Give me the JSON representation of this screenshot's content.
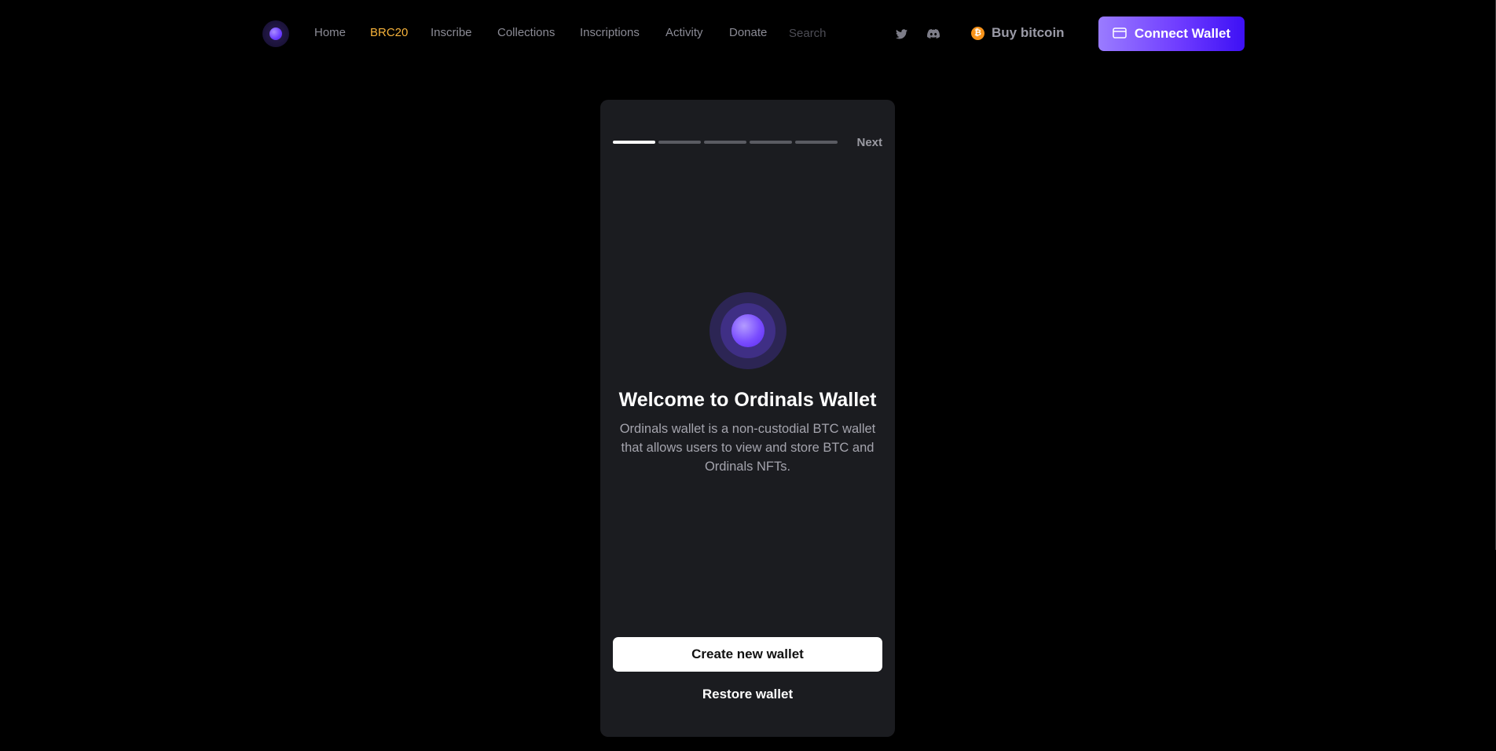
{
  "nav": {
    "links": [
      {
        "label": "Home",
        "active": false
      },
      {
        "label": "BRC20",
        "active": true
      },
      {
        "label": "Inscribe",
        "active": false
      },
      {
        "label": "Collections",
        "active": false
      },
      {
        "label": "Inscriptions",
        "active": false
      },
      {
        "label": "Activity",
        "active": false
      },
      {
        "label": "Donate",
        "active": false
      }
    ],
    "search": {
      "placeholder": "Search",
      "value": ""
    },
    "social_icons": [
      "twitter-icon",
      "discord-icon"
    ],
    "buy_bitcoin": {
      "label": "Buy bitcoin",
      "icon": "bitcoin-icon",
      "icon_glyph": "₿"
    },
    "connect_wallet": {
      "label": "Connect Wallet",
      "icon": "wallet-icon"
    }
  },
  "onboarding": {
    "progress": {
      "current_step": 1,
      "total_steps": 5
    },
    "next_label": "Next",
    "title": "Welcome to Ordinals Wallet",
    "description": "Ordinals wallet is a non-custodial BTC wallet that allows users to view and store BTC and Ordinals NFTs.",
    "create_label": "Create new wallet",
    "restore_label": "Restore wallet"
  },
  "colors": {
    "background": "#000000",
    "card": "#1b1c20",
    "nav_text": "#8b8b95",
    "nav_active": "#f6b23a",
    "accent_start": "#9a7cff",
    "accent_end": "#3d10f5",
    "bitcoin": "#f7931a"
  }
}
